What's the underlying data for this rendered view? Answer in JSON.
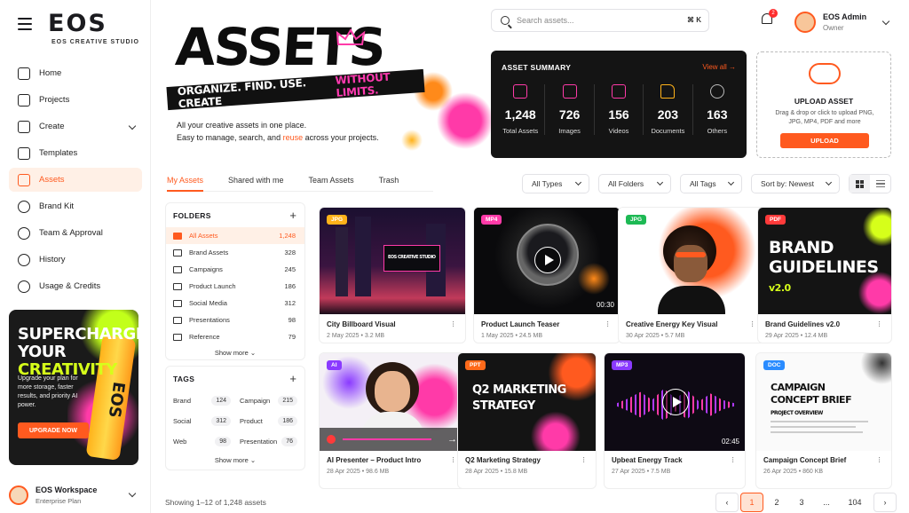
{
  "brand": {
    "name": "EOS",
    "subtitle": "EOS CREATIVE STUDIO",
    "accent": "#ff5a1f"
  },
  "sidebar": {
    "items": [
      {
        "label": "Home",
        "icon": "home-icon"
      },
      {
        "label": "Projects",
        "icon": "projects-icon"
      },
      {
        "label": "Create",
        "icon": "create-icon"
      },
      {
        "label": "Templates",
        "icon": "templates-icon"
      },
      {
        "label": "Assets",
        "icon": "assets-icon",
        "active": true
      },
      {
        "label": "Brand Kit",
        "icon": "brand-kit-icon"
      },
      {
        "label": "Team & Approval",
        "icon": "team-icon"
      },
      {
        "label": "History",
        "icon": "history-icon"
      },
      {
        "label": "Usage & Credits",
        "icon": "usage-icon"
      }
    ],
    "promo": {
      "title_1": "SUPERCHARGE",
      "title_2": "YOUR",
      "title_3": "CREATIVITY",
      "text": "Upgrade your plan for more storage, faster results, and priority AI power.",
      "button": "UPGRADE NOW",
      "can_label": "EOS"
    },
    "workspace": {
      "name": "EOS Workspace",
      "plan": "Enterprise Plan"
    }
  },
  "topbar": {
    "search_placeholder": "Search assets...",
    "shortcut": "⌘ K",
    "notifications": "2",
    "user_name": "EOS Admin",
    "user_role": "Owner"
  },
  "hero": {
    "title": "ASSETS",
    "banner_1": "ORGANIZE. FIND. USE. CREATE",
    "banner_2": "WITHOUT LIMITS.",
    "sub_1": "All your creative assets in one place.",
    "sub_2a": "Easy to manage, search, and ",
    "sub_2b": "reuse",
    "sub_2c": " across your projects."
  },
  "summary": {
    "title": "ASSET SUMMARY",
    "link": "View all →",
    "items": [
      {
        "value": "1,248",
        "label": "Total Assets",
        "icon": "image-icon"
      },
      {
        "value": "726",
        "label": "Images",
        "icon": "image-icon"
      },
      {
        "value": "156",
        "label": "Videos",
        "icon": "video-icon"
      },
      {
        "value": "203",
        "label": "Documents",
        "icon": "document-icon"
      },
      {
        "value": "163",
        "label": "Others",
        "icon": "more-icon"
      }
    ]
  },
  "upload": {
    "title": "UPLOAD ASSET",
    "text": "Drag & drop or click to upload PNG, JPG, MP4, PDF and more",
    "button": "UPLOAD"
  },
  "tabs": [
    "My Assets",
    "Shared with me",
    "Team Assets",
    "Trash"
  ],
  "filters": {
    "type": "All Types",
    "folders": "All Folders",
    "tags": "All Tags",
    "sort": "Sort by: Newest"
  },
  "folders": {
    "title": "FOLDERS",
    "items": [
      {
        "name": "All Assets",
        "count": "1,248"
      },
      {
        "name": "Brand Assets",
        "count": "328"
      },
      {
        "name": "Campaigns",
        "count": "245"
      },
      {
        "name": "Product Launch",
        "count": "186"
      },
      {
        "name": "Social Media",
        "count": "312"
      },
      {
        "name": "Presentations",
        "count": "98"
      },
      {
        "name": "Reference",
        "count": "79"
      }
    ],
    "show_more": "Show more ⌄"
  },
  "tags": {
    "title": "TAGS",
    "items": [
      {
        "name": "Brand",
        "count": "124"
      },
      {
        "name": "Campaign",
        "count": "215"
      },
      {
        "name": "Social",
        "count": "312"
      },
      {
        "name": "Product",
        "count": "186"
      },
      {
        "name": "Web",
        "count": "98"
      },
      {
        "name": "Presentation",
        "count": "76"
      }
    ],
    "show_more": "Show more ⌄"
  },
  "assets": [
    {
      "type": "JPG",
      "title": "City Billboard Visual",
      "meta": "2 May 2025 • 3.2 MB",
      "badge_color": "#ffb21a",
      "thumb_text": "EOS CREATIVE STUDIO"
    },
    {
      "type": "MP4",
      "title": "Product Launch Teaser",
      "meta": "1 May 2025 • 24.5 MB",
      "badge_color": "#ff3aa8",
      "duration": "00:30"
    },
    {
      "type": "JPG",
      "title": "Creative Energy Key Visual",
      "meta": "30 Apr 2025 • 5.7 MB",
      "badge_color": "#1db954"
    },
    {
      "type": "PDF",
      "title": "Brand Guidelines v2.0",
      "meta": "29 Apr 2025 • 12.4 MB",
      "badge_color": "#ff3a3a",
      "thumb_text_1": "BRAND",
      "thumb_text_2": "GUIDELINES",
      "thumb_text_3": "v2.0"
    },
    {
      "type": "AI",
      "title": "AI Presenter – Product Intro",
      "meta": "28 Apr 2025 • 98.6 MB",
      "badge_color": "#8a3aff"
    },
    {
      "type": "PPT",
      "title": "Q2 Marketing Strategy",
      "meta": "28 Apr 2025 • 15.8 MB",
      "badge_color": "#ff6a1a",
      "thumb_text_1": "Q2 MARKETING",
      "thumb_text_2": "STRATEGY"
    },
    {
      "type": "MP3",
      "title": "Upbeat Energy Track",
      "meta": "27 Apr 2025 • 7.5 MB",
      "badge_color": "#8a3aff",
      "duration": "02:45"
    },
    {
      "type": "DOC",
      "title": "Campaign Concept Brief",
      "meta": "26 Apr 2025 • 860 KB",
      "badge_color": "#2a8cff",
      "thumb_text_1": "CAMPAIGN",
      "thumb_text_2": "CONCEPT BRIEF",
      "thumb_text_3": "PROJECT OVERVIEW"
    }
  ],
  "pagination": {
    "info": "Showing 1–12 of 1,248 assets",
    "pages": [
      "1",
      "2",
      "3",
      "...",
      "104"
    ],
    "prev": "‹",
    "next": "›"
  }
}
